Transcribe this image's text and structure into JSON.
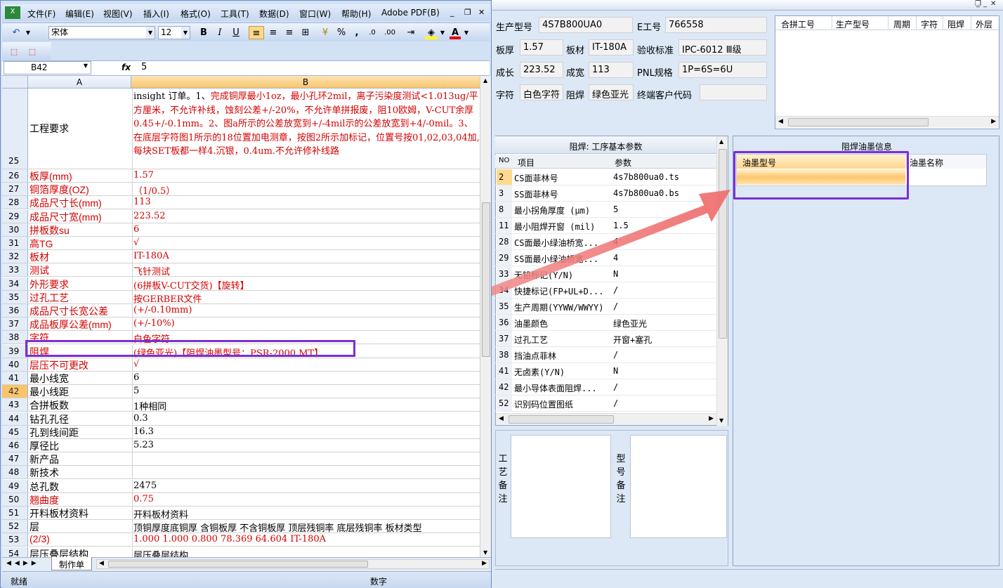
{
  "excel": {
    "menu": [
      "文件(F)",
      "编辑(E)",
      "视图(V)",
      "插入(I)",
      "格式(O)",
      "工具(T)",
      "数据(D)",
      "窗口(W)",
      "帮助(H)",
      "Adobe PDF(B)"
    ],
    "toolbar": {
      "font_name": "宋体",
      "font_size": "12",
      "bold": "B",
      "italic": "I",
      "underline": "U",
      "percent": "%",
      "comma": ","
    },
    "name_box": "B42",
    "fx": "fx",
    "formula": "5",
    "col_a": "A",
    "col_b": "B",
    "row25": {
      "num": "25",
      "a": "工程要求",
      "b_black": "insight 订单。1、",
      "b_red": "完成铜厚最小1oz，最小孔环2mil，离子污染度测试<1.013ug/平方厘米，不允许补线，蚀刻公差+/-20%，不允许单拼报废，阻10欧姆，V-CUT余厚0.45+/-0.1mm。2、图a所示的公差放宽到+/-4mil示的公差放宽到+4/-0mil。3、在底层字符图1所示的18位置加电测章，按图2所示加标记，位置号按01,02,03,04加,每块SET板都一样4.沉银，0.4um.不允许修补线路"
    },
    "rows": [
      {
        "num": "26",
        "a": "板厚(mm)",
        "b": "1.57",
        "red": true
      },
      {
        "num": "27",
        "a": "铜箔厚度(OZ)",
        "b": "（1/0.5）",
        "red": true
      },
      {
        "num": "28",
        "a": "成品尺寸长(mm)",
        "b": "113",
        "red": true
      },
      {
        "num": "29",
        "a": "成品尺寸宽(mm)",
        "b": "223.52",
        "red": true
      },
      {
        "num": "30",
        "a": "拼板数su",
        "b": "6",
        "red": true
      },
      {
        "num": "31",
        "a": "高TG",
        "b": "√",
        "red": true
      },
      {
        "num": "32",
        "a": "板材",
        "b": "IT-180A",
        "red": true
      },
      {
        "num": "33",
        "a": "测试",
        "b": "飞针测试",
        "red": true
      },
      {
        "num": "34",
        "a": "外形要求",
        "b": "(6拼板V-CUT交货)【旋转】",
        "red": true
      },
      {
        "num": "35",
        "a": "过孔工艺",
        "b": "按GERBER文件",
        "red": true
      },
      {
        "num": "36",
        "a": "成品尺寸长宽公差",
        "b": "(+/-0.10mm)",
        "red": true
      },
      {
        "num": "37",
        "a": "成品板厚公差(mm)",
        "b": "(+/-10%)",
        "red": true
      },
      {
        "num": "38",
        "a": "字符",
        "b": "白色字符",
        "red": true
      },
      {
        "num": "39",
        "a": "阻焊",
        "b": "(绿色亚光)【阻焊油墨型号：PSR-2000 MT】",
        "red": true
      },
      {
        "num": "40",
        "a": "层压不可更改",
        "b": "√",
        "red": true
      },
      {
        "num": "41",
        "a": "最小线宽",
        "b": "6",
        "red": false
      },
      {
        "num": "42",
        "a": "最小线距",
        "b": "5",
        "red": false,
        "active": true
      },
      {
        "num": "43",
        "a": "合拼板数",
        "b": "1种相同",
        "red": false
      },
      {
        "num": "44",
        "a": "钻孔孔径",
        "b": "0.3",
        "red": false
      },
      {
        "num": "45",
        "a": "孔到线间距",
        "b": "16.3",
        "red": false
      },
      {
        "num": "46",
        "a": "厚径比",
        "b": "5.23",
        "red": false
      },
      {
        "num": "47",
        "a": "新产品",
        "b": "",
        "red": false
      },
      {
        "num": "48",
        "a": "新技术",
        "b": "",
        "red": false
      },
      {
        "num": "49",
        "a": "总孔数",
        "b": "2475",
        "red": false
      },
      {
        "num": "50",
        "a": "翘曲度",
        "b": "0.75",
        "red": true
      },
      {
        "num": "51",
        "a": "开料板材资料",
        "b": "开料板材资料",
        "red": false
      },
      {
        "num": "52",
        "a": "层",
        "b": "顶铜厚度底铜厚 含铜板厚  不含铜板厚  顶层残铜率  底层残铜率  板材类型",
        "red": false
      },
      {
        "num": "53",
        "a": "(2/3)",
        "b": "1.000  1.000          0.800       78.369     64.604      IT-180A",
        "red": true
      },
      {
        "num": "54",
        "a": "层压叠层结构",
        "b": "层压叠层结构",
        "red": false
      }
    ],
    "sheet_tab": "制作单",
    "status_left": "就绪",
    "status_num": "数字"
  },
  "app": {
    "fields": {
      "prod_model_label": "生产型号",
      "prod_model": "4S7B800UA0",
      "e_no_label": "E工号",
      "e_no": "766558",
      "thickness_label": "板厚",
      "thickness": "1.57",
      "material_label": "板材",
      "material": "IT-180A",
      "accept_label": "验收标准",
      "accept": "IPC-6012 Ⅲ级",
      "length_label": "成长",
      "length": "223.52",
      "width_label": "成宽",
      "width": "113",
      "pnl_label": "PNL规格",
      "pnl": "1P=6S=6U",
      "char_label": "字符",
      "char": "白色字符",
      "mask_label": "阻焊",
      "mask": "绿色亚光",
      "end_customer_label": "终端客户代码",
      "end_customer": ""
    },
    "merge_table": {
      "headers": [
        "合拼工号",
        "生产型号",
        "周期",
        "字符",
        "阻焊",
        "外层"
      ]
    },
    "params": {
      "title": "阻焊: 工序基本参数",
      "headers": {
        "no": "NO",
        "item": "项目",
        "value": "参数"
      },
      "rows": [
        {
          "no": "2",
          "item": "CS面菲林号",
          "value": "4s7b800ua0.ts",
          "sel": true
        },
        {
          "no": "3",
          "item": "SS面菲林号",
          "value": "4s7b800ua0.bs"
        },
        {
          "no": "8",
          "item": "最小拐角厚度 (μm)",
          "value": "5"
        },
        {
          "no": "11",
          "item": "最小阻焊开窗 (mil)",
          "value": "1.5"
        },
        {
          "no": "28",
          "item": "CS面最小绿油桥宽...",
          "value": "4"
        },
        {
          "no": "29",
          "item": "SS面最小绿油桥宽...",
          "value": "4"
        },
        {
          "no": "33",
          "item": "无铅标记(Y/N)",
          "value": "N"
        },
        {
          "no": "34",
          "item": "快捷标记(FP+UL+D...",
          "value": "/"
        },
        {
          "no": "35",
          "item": "生产周期(YYWW/WWYY)",
          "value": "/"
        },
        {
          "no": "36",
          "item": "油墨颜色",
          "value": "绿色亚光"
        },
        {
          "no": "37",
          "item": "过孔工艺",
          "value": "开窗+塞孔"
        },
        {
          "no": "38",
          "item": "挡油点菲林",
          "value": "/"
        },
        {
          "no": "41",
          "item": "无卤素(Y/N)",
          "value": "N"
        },
        {
          "no": "42",
          "item": "最小导体表面阻焊...",
          "value": "/"
        },
        {
          "no": "52",
          "item": "识别码位置图纸",
          "value": "/"
        }
      ]
    },
    "notes": {
      "process_label": "工艺备注",
      "model_label": "型号备注"
    },
    "ink": {
      "title": "阻焊油墨信息",
      "col_model": "油墨型号",
      "col_name": "油墨名称"
    }
  },
  "colors": {
    "highlight": "#7b2fd6",
    "arrow": "#f07070",
    "red_text": "#d40000"
  }
}
